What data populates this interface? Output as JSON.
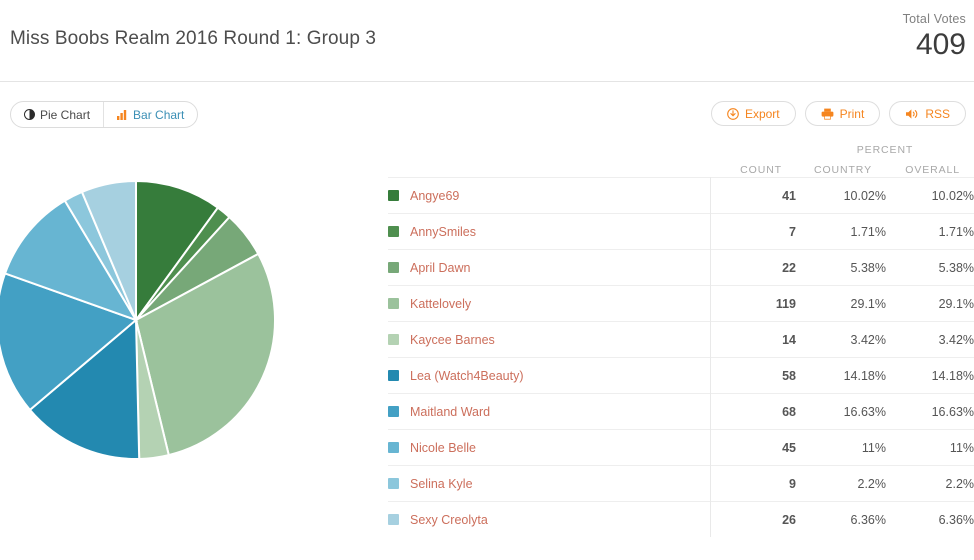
{
  "header": {
    "title": "Miss Boobs Realm 2016 Round 1: Group 3",
    "total_votes_label": "Total Votes",
    "total_votes_value": "409"
  },
  "toolbar": {
    "chart_types": [
      {
        "label": "Pie Chart",
        "icon": "pie-chart-icon",
        "active": true
      },
      {
        "label": "Bar Chart",
        "icon": "bar-chart-icon",
        "active": false
      }
    ],
    "actions": [
      {
        "label": "Export",
        "icon": "download-circle-icon"
      },
      {
        "label": "Print",
        "icon": "printer-icon"
      },
      {
        "label": "RSS",
        "icon": "rss-speaker-icon"
      }
    ]
  },
  "table": {
    "headers": {
      "count": "COUNT",
      "percent": "PERCENT",
      "country": "COUNTRY",
      "overall": "OVERALL"
    },
    "rows": [
      {
        "name": "Angye69",
        "color": "#367c3b",
        "count": "41",
        "country": "10.02%",
        "overall": "10.02%"
      },
      {
        "name": "AnnySmiles",
        "color": "#4f8f4f",
        "count": "7",
        "country": "1.71%",
        "overall": "1.71%"
      },
      {
        "name": "April Dawn",
        "color": "#77a878",
        "count": "22",
        "country": "5.38%",
        "overall": "5.38%"
      },
      {
        "name": "Kattelovely",
        "color": "#9bc29c",
        "count": "119",
        "country": "29.1%",
        "overall": "29.1%"
      },
      {
        "name": "Kaycee Barnes",
        "color": "#b4d2b3",
        "count": "14",
        "country": "3.42%",
        "overall": "3.42%"
      },
      {
        "name": "Lea (Watch4Beauty)",
        "color": "#2389b0",
        "count": "58",
        "country": "14.18%",
        "overall": "14.18%"
      },
      {
        "name": "Maitland Ward",
        "color": "#43a0c4",
        "count": "68",
        "country": "16.63%",
        "overall": "16.63%"
      },
      {
        "name": "Nicole Belle",
        "color": "#67b5d2",
        "count": "45",
        "country": "11%",
        "overall": "11%"
      },
      {
        "name": "Selina Kyle",
        "color": "#8cc7dc",
        "count": "9",
        "country": "2.2%",
        "overall": "2.2%"
      },
      {
        "name": "Sexy Creolyta",
        "color": "#a6d0e0",
        "count": "26",
        "country": "6.36%",
        "overall": "6.36%"
      }
    ]
  },
  "chart_data": {
    "type": "pie",
    "title": "Miss Boobs Realm 2016 Round 1: Group 3",
    "total": 409,
    "start_angle_deg": 0,
    "direction": "clockwise",
    "legend_position": "right-table",
    "labels": [
      "Angye69",
      "AnnySmiles",
      "April Dawn",
      "Kattelovely",
      "Kaycee Barnes",
      "Lea (Watch4Beauty)",
      "Maitland Ward",
      "Nicole Belle",
      "Selina Kyle",
      "Sexy Creolyta"
    ],
    "values": [
      41,
      7,
      22,
      119,
      14,
      58,
      68,
      45,
      9,
      26
    ],
    "percents": [
      10.02,
      1.71,
      5.38,
      29.1,
      3.42,
      14.18,
      16.63,
      11,
      2.2,
      6.36
    ],
    "colors": [
      "#367c3b",
      "#4f8f4f",
      "#77a878",
      "#9bc29c",
      "#b4d2b3",
      "#2389b0",
      "#43a0c4",
      "#67b5d2",
      "#8cc7dc",
      "#a6d0e0"
    ]
  }
}
